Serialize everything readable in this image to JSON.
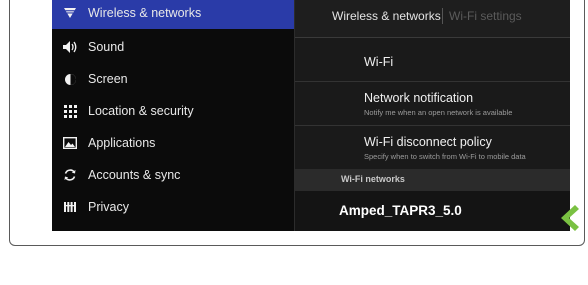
{
  "sidebar": {
    "items": [
      {
        "label": "Wireless & networks",
        "icon": "wifi-signal-icon"
      },
      {
        "label": "Sound",
        "icon": "speaker-icon"
      },
      {
        "label": "Screen",
        "icon": "brightness-icon"
      },
      {
        "label": "Location & security",
        "icon": "keypad-grid-icon"
      },
      {
        "label": "Applications",
        "icon": "applications-icon"
      },
      {
        "label": "Accounts & sync",
        "icon": "sync-icon"
      },
      {
        "label": "Privacy",
        "icon": "privacy-icon"
      }
    ]
  },
  "header": {
    "breadcrumb_parent": "Wireless & networks",
    "breadcrumb_current": "Wi-Fi settings"
  },
  "settings": [
    {
      "title": "Wi-Fi",
      "subtitle": ""
    },
    {
      "title": "Network notification",
      "subtitle": "Notify me when an open network is available"
    },
    {
      "title": "Wi-Fi disconnect policy",
      "subtitle": "Specify when to switch from Wi-Fi to mobile data"
    }
  ],
  "networks_section": {
    "label": "Wi-Fi networks",
    "items": [
      {
        "name": "Amped_TAPR3_5.0"
      }
    ]
  },
  "colors": {
    "active_item": "#2a3ba8",
    "pointer_accent": "#7ac142"
  }
}
